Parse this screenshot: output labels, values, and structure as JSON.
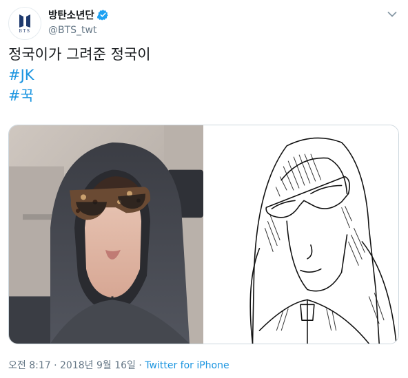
{
  "author": {
    "display_name": "방탄소년단",
    "handle": "@BTS_twt",
    "verified": true,
    "avatar_logo_text": "BTS"
  },
  "tweet": {
    "text_line": "정국이가 그려준 정국이",
    "hashtags": [
      "#JK",
      "#꾹"
    ]
  },
  "media": {
    "images": [
      {
        "kind": "photo",
        "description_icon": "photo-selfie"
      },
      {
        "kind": "drawing",
        "description_icon": "line-drawing"
      }
    ]
  },
  "meta": {
    "time": "오전 8:17",
    "separator": " · ",
    "date": "2018년 9월 16일",
    "source": "Twitter for iPhone"
  },
  "colors": {
    "link": "#1b95e0",
    "secondary_text": "#657786",
    "verified_badge": "#1da1f2"
  }
}
